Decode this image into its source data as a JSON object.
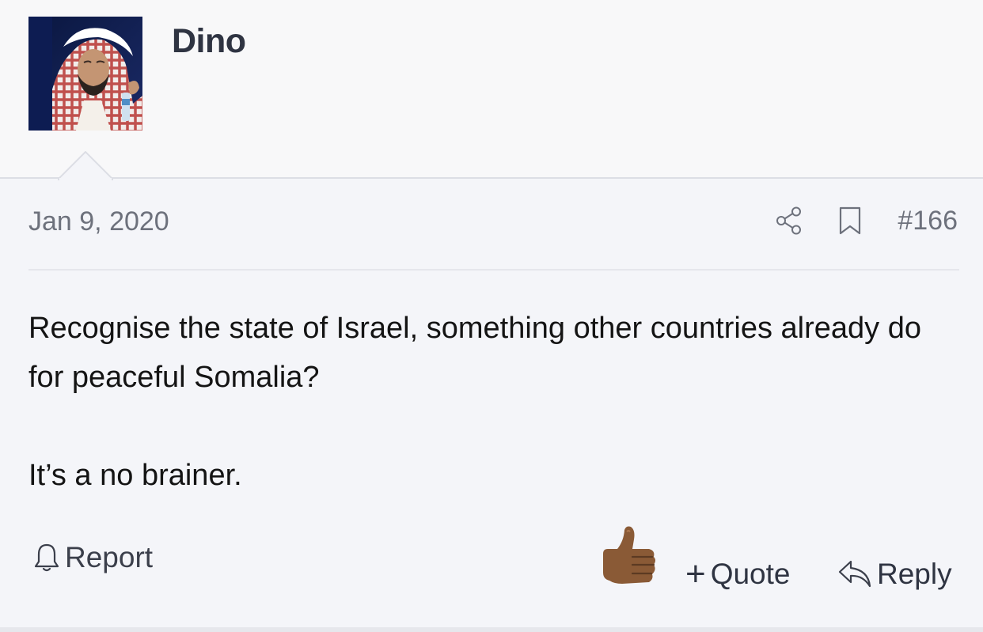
{
  "post": {
    "username": "Dino",
    "date": "Jan 9, 2020",
    "post_number": "#166",
    "message": {
      "paragraph_1": "Recognise the state of Israel, something other countries already do for peaceful Somalia?",
      "paragraph_2": "It’s a no brainer."
    }
  },
  "actions": {
    "report_label": "Report",
    "quote_plus": "+",
    "quote_label": "Quote",
    "reply_label": "Reply"
  },
  "icons": {
    "share": "share-icon",
    "bookmark": "bookmark-icon",
    "report": "bell-icon",
    "reaction": "thumbs-up-icon",
    "reply": "reply-arrow-icon"
  },
  "colors": {
    "header_bg": "#f8f8f9",
    "body_bg": "#f4f5f9",
    "meta_text": "#6d717c",
    "username": "#2f3442",
    "thumb": "#8a5a36"
  }
}
